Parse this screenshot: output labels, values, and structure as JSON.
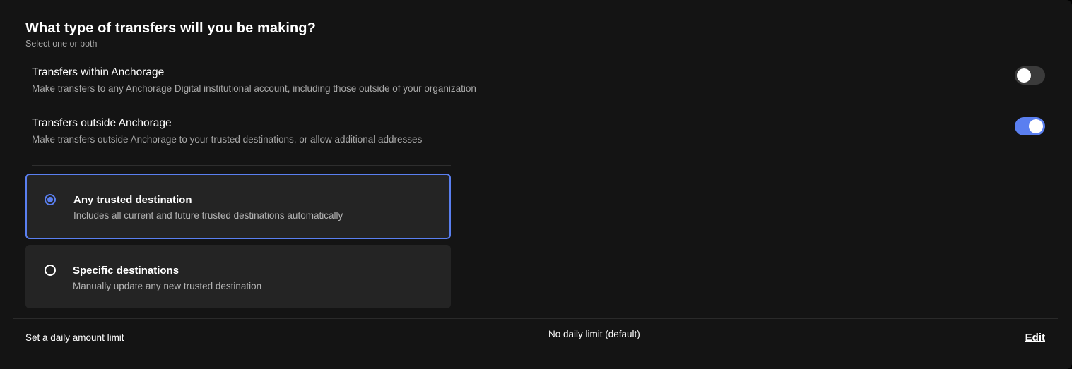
{
  "section": {
    "title": "What type of transfers will you be making?",
    "subtitle": "Select one or both"
  },
  "transfer_types": [
    {
      "title": "Transfers within Anchorage",
      "description": "Make transfers to any Anchorage Digital institutional account, including those outside of your organization",
      "enabled": false
    },
    {
      "title": "Transfers outside Anchorage",
      "description": "Make transfers outside Anchorage to your trusted destinations, or allow additional addresses",
      "enabled": true
    }
  ],
  "destination_options": [
    {
      "title": "Any trusted destination",
      "description": "Includes all current and future trusted destinations automatically",
      "selected": true
    },
    {
      "title": "Specific destinations",
      "description": "Manually update any new trusted destination",
      "selected": false
    }
  ],
  "daily_limit": {
    "label": "Set a daily amount limit",
    "value": "No daily limit (default)",
    "edit_label": "Edit"
  },
  "colors": {
    "accent": "#5a7ff0",
    "background": "#141414",
    "card": "#242424"
  }
}
